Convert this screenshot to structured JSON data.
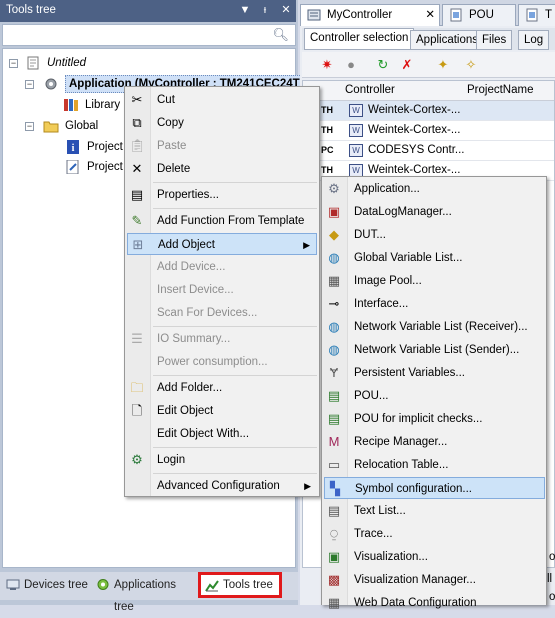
{
  "left_pane": {
    "title": "Tools tree",
    "title_buttons": [
      "▼",
      "ᵻ",
      "✕"
    ],
    "tree": [
      {
        "label": "Untitled"
      },
      {
        "label": "Application (MyController : TM241CEC24T"
      },
      {
        "label": "Library M"
      },
      {
        "label": "Global"
      },
      {
        "label": "Project"
      },
      {
        "label": "Project"
      }
    ],
    "bottom_tabs": [
      {
        "label": "Devices tree"
      },
      {
        "label": "Applications tree"
      },
      {
        "label": "Tools tree"
      }
    ]
  },
  "editor": {
    "tabs": [
      {
        "label": "MyController"
      },
      {
        "label": "POU"
      },
      {
        "label": "T"
      }
    ],
    "sub_tabs": [
      "Controller selection",
      "Applications",
      "Files",
      "Log"
    ],
    "grid": {
      "columns": [
        "Controller",
        "ProjectName"
      ],
      "rows": [
        {
          "prefix": "TH",
          "icon": "W",
          "name": "Weintek-Cortex-..."
        },
        {
          "prefix": "TH",
          "icon": "W",
          "name": "Weintek-Cortex-..."
        },
        {
          "prefix": "PC",
          "icon": "W",
          "name": "CODESYS Contr..."
        },
        {
          "prefix": "TH",
          "icon": "W",
          "name": "Weintek-Cortex-..."
        }
      ]
    },
    "side_chars": [
      "o",
      "ll",
      "o"
    ]
  },
  "context_menu": {
    "items": [
      {
        "label": "Cut",
        "icon": "scissors-icon",
        "disabled": false
      },
      {
        "label": "Copy",
        "icon": "copy-icon",
        "disabled": false
      },
      {
        "label": "Paste",
        "icon": "paste-icon",
        "disabled": true
      },
      {
        "label": "Delete",
        "icon": "delete-icon",
        "disabled": false
      },
      {
        "label": "Properties...",
        "icon": "properties-icon",
        "disabled": false
      },
      {
        "label": "Add Function From Template",
        "icon": "template-icon",
        "disabled": false
      },
      {
        "label": "Add Object",
        "icon": "add-object-icon",
        "disabled": false
      },
      {
        "label": "Add Device...",
        "icon": "",
        "disabled": true
      },
      {
        "label": "Insert Device...",
        "icon": "",
        "disabled": true
      },
      {
        "label": "Scan For Devices...",
        "icon": "",
        "disabled": true
      },
      {
        "label": "IO Summary...",
        "icon": "io-summary-icon",
        "disabled": true
      },
      {
        "label": "Power consumption...",
        "icon": "",
        "disabled": true
      },
      {
        "label": "Add Folder...",
        "icon": "folder-icon",
        "disabled": false
      },
      {
        "label": "Edit Object",
        "icon": "edit-object-icon",
        "disabled": false
      },
      {
        "label": "Edit Object With...",
        "icon": "",
        "disabled": false
      },
      {
        "label": "Login",
        "icon": "login-icon",
        "disabled": false
      },
      {
        "label": "Advanced Configuration",
        "icon": "",
        "disabled": false
      }
    ]
  },
  "submenu": {
    "items": [
      {
        "label": "Application..."
      },
      {
        "label": "DataLogManager..."
      },
      {
        "label": "DUT..."
      },
      {
        "label": "Global Variable List..."
      },
      {
        "label": "Image Pool..."
      },
      {
        "label": "Interface..."
      },
      {
        "label": "Network Variable List (Receiver)..."
      },
      {
        "label": "Network Variable List (Sender)..."
      },
      {
        "label": "Persistent Variables..."
      },
      {
        "label": "POU..."
      },
      {
        "label": "POU for implicit checks..."
      },
      {
        "label": "Recipe Manager..."
      },
      {
        "label": "Relocation Table..."
      },
      {
        "label": "Symbol configuration..."
      },
      {
        "label": "Text List..."
      },
      {
        "label": "Trace..."
      },
      {
        "label": "Visualization..."
      },
      {
        "label": "Visualization Manager..."
      },
      {
        "label": "Web Data Configuration"
      }
    ]
  }
}
